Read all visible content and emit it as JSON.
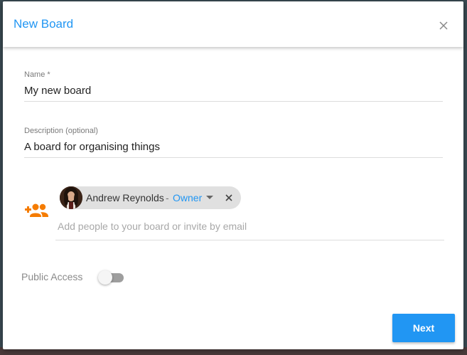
{
  "dialog": {
    "title": "New Board",
    "close_icon": "close-icon"
  },
  "form": {
    "name": {
      "label": "Name *",
      "value": "My new board"
    },
    "description": {
      "label": "Description (optional)",
      "value": "A board for organising things"
    },
    "members": {
      "icon": "add-people-icon",
      "chips": [
        {
          "name": "Andrew Reynolds",
          "separator": "-",
          "role": "Owner",
          "role_icon": "caret-down-icon",
          "remove_icon": "close-icon"
        }
      ],
      "invite_placeholder": "Add people to your board or invite by email"
    },
    "public_access": {
      "label": "Public Access",
      "enabled": false
    }
  },
  "actions": {
    "next_label": "Next"
  },
  "colors": {
    "accent": "#2196f3",
    "people_icon": "#f57c00",
    "chip_bg": "#e0e0e0"
  }
}
